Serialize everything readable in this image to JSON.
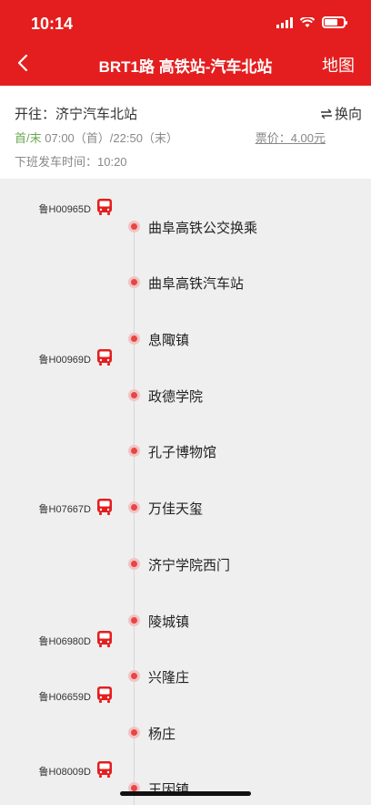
{
  "status_bar": {
    "time": "10:14"
  },
  "header": {
    "title": "BRT1路 高铁站-汽车北站",
    "map_label": "地图"
  },
  "info": {
    "destination": "开往：济宁汽车北站",
    "swap_label": "换向",
    "first_last_tag": "首/末",
    "times": "07:00（首）/22:50（末）",
    "fare": "票价：4.00元",
    "last_dispatch": "下班发车时间：10:20"
  },
  "stops": [
    "曲阜高铁公交换乘",
    "曲阜高铁汽车站",
    "息陬镇",
    "政德学院",
    "孔子博物馆",
    "万佳天玺",
    "济宁学院西门",
    "陵城镇",
    "兴隆庄",
    "杨庄",
    "王因镇"
  ],
  "buses": [
    {
      "plate": "鲁H00965D"
    },
    {
      "plate": "鲁H00969D"
    },
    {
      "plate": "鲁H07667D"
    },
    {
      "plate": "鲁H06980D"
    },
    {
      "plate": "鲁H06659D"
    },
    {
      "plate": "鲁H08009D"
    }
  ],
  "colors": {
    "brand": "#e41e1e",
    "stop_dot": "#e84545",
    "green_tag": "#6aa84f"
  }
}
